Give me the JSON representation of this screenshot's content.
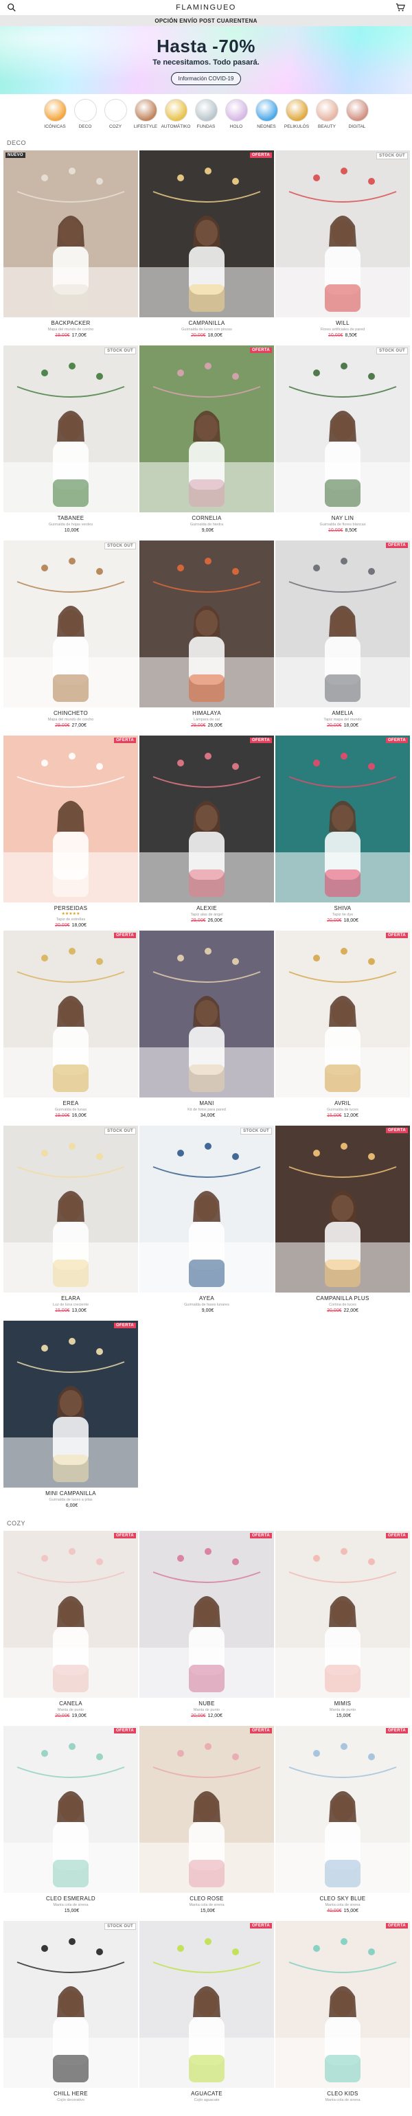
{
  "header": {
    "brand": "FLAMINGUEO",
    "icons": [
      "search-icon",
      "cart-icon"
    ]
  },
  "notice": "OPCIÓN ENVÍO POST CUARENTENA",
  "hero": {
    "title": "Hasta -70%",
    "subtitle": "Te necesitamos. Todo pasará.",
    "button": "Información COVID-19"
  },
  "categories": [
    {
      "label": "ICÓNICAS",
      "color": "#f4a63a"
    },
    {
      "label": "DECO",
      "color": "#ffffff"
    },
    {
      "label": "COZY",
      "color": "#ffffff"
    },
    {
      "label": "LIFESTYLE",
      "color": "#c0845c"
    },
    {
      "label": "AUTOMÁTIKO",
      "color": "#e8c24a"
    },
    {
      "label": "FUNDAS",
      "color": "#b9c6cc"
    },
    {
      "label": "HOLO",
      "color": "#d6b8e6"
    },
    {
      "label": "NEONES",
      "color": "#4aa8e8"
    },
    {
      "label": "PELIKULÓS",
      "color": "#e0a93c"
    },
    {
      "label": "BEAUTY",
      "color": "#e7b5a2"
    },
    {
      "label": "DIGITAL",
      "color": "#d09080"
    }
  ],
  "sections": [
    {
      "title": "DECO",
      "products": [
        {
          "name": "BACKPACKER",
          "desc": "Mapa del mundo de corcho",
          "old": "19,00€",
          "now": "17,00€",
          "badge": "NUEVO",
          "badge_type": "nuevo",
          "bg": "#c9b8a8",
          "accent": "#e9e2d8"
        },
        {
          "name": "CAMPANILLA",
          "desc": "Guirnalda de luces con pinzas",
          "old": "20,00€",
          "now": "18,00€",
          "badge": "OFERTA",
          "badge_type": "sale",
          "bg": "#3b3734",
          "accent": "#f5d58a"
        },
        {
          "name": "WILL",
          "desc": "Flores artificiales de pared",
          "old": "10,00€",
          "now": "8,50€",
          "badge": "STOCK OUT",
          "badge_type": "stock",
          "bg": "#e6e3e3",
          "accent": "#d84a4a"
        },
        {
          "name": "TABANEE",
          "desc": "Guirnalda de hojas verdes",
          "old": "",
          "now": "10,00€",
          "badge": "STOCK OUT",
          "badge_type": "stock",
          "bg": "#e9e8e4",
          "accent": "#3f7a3a"
        },
        {
          "name": "CORNELIA",
          "desc": "Guirnalda de hiedra",
          "old": "",
          "now": "9,00€",
          "badge": "OFERTA",
          "badge_type": "sale",
          "bg": "#7c9a66",
          "accent": "#d9a4b3"
        },
        {
          "name": "NAY LIN",
          "desc": "Guirnalda de flores blancas",
          "old": "10,00€",
          "now": "8,50€",
          "badge": "STOCK OUT",
          "badge_type": "stock",
          "bg": "#ececec",
          "accent": "#3f6e3a"
        },
        {
          "name": "CHINCHETO",
          "desc": "Mapa del mundo de corcho",
          "old": "29,00€",
          "now": "27,00€",
          "badge": "STOCK OUT",
          "badge_type": "stock",
          "bg": "#f3f1ee",
          "accent": "#b0804f"
        },
        {
          "name": "HIMALAYA",
          "desc": "Lámpara de sal",
          "old": "29,00€",
          "now": "26,00€",
          "badge": "",
          "badge_type": "",
          "bg": "#5a4a44",
          "accent": "#e06a3a"
        },
        {
          "name": "AMELIA",
          "desc": "Tapiz mapa del mundo",
          "old": "20,00€",
          "now": "18,00€",
          "badge": "OFERTA",
          "badge_type": "sale",
          "bg": "#dcdcdc",
          "accent": "#666a70"
        },
        {
          "name": "PERSEIDAS",
          "desc": "Tapiz de estrellas",
          "old": "20,00€",
          "now": "18,00€",
          "badge": "OFERTA",
          "badge_type": "sale",
          "bg": "#f4c7b6",
          "accent": "#ffffff",
          "stars": "★★★★★"
        },
        {
          "name": "ALEXIE",
          "desc": "Tapiz alas de ángel",
          "old": "29,00€",
          "now": "26,00€",
          "badge": "OFERTA",
          "badge_type": "sale",
          "bg": "#3a3a3a",
          "accent": "#e77c8a"
        },
        {
          "name": "SHIVA",
          "desc": "Tapiz tie dye",
          "old": "20,00€",
          "now": "18,00€",
          "badge": "OFERTA",
          "badge_type": "sale",
          "bg": "#2a7d7a",
          "accent": "#e84a6a"
        },
        {
          "name": "EREA",
          "desc": "Guirnalda de lunas",
          "old": "19,00€",
          "now": "16,00€",
          "badge": "OFERTA",
          "badge_type": "sale",
          "bg": "#ece9e4",
          "accent": "#d9b25a"
        },
        {
          "name": "MANI",
          "desc": "Kit de fotos para pared",
          "old": "",
          "now": "34,00€",
          "badge": "",
          "badge_type": "",
          "bg": "#6a6478",
          "accent": "#e8d4b0"
        },
        {
          "name": "AVRIL",
          "desc": "Guirnalda de luces",
          "old": "15,00€",
          "now": "12,00€",
          "badge": "OFERTA",
          "badge_type": "sale",
          "bg": "#f1ede8",
          "accent": "#d6a64a"
        },
        {
          "name": "ELARA",
          "desc": "Luz de luna creciente",
          "old": "15,00€",
          "now": "13,00€",
          "badge": "STOCK OUT",
          "badge_type": "stock",
          "bg": "#e6e4e0",
          "accent": "#f2dba0"
        },
        {
          "name": "AYEA",
          "desc": "Guirnalda de fases lunares",
          "old": "",
          "now": "9,00€",
          "badge": "STOCK OUT",
          "badge_type": "stock",
          "bg": "#eef1f4",
          "accent": "#2f5a8a"
        },
        {
          "name": "CAMPANILLA PLUS",
          "desc": "Cortina de luces",
          "old": "30,00€",
          "now": "22,00€",
          "badge": "OFERTA",
          "badge_type": "sale",
          "bg": "#4d3b33",
          "accent": "#f5c77a"
        },
        {
          "name": "MINI CAMPANILLA",
          "desc": "Guirnalda de luces a pilas",
          "old": "",
          "now": "6,00€",
          "badge": "OFERTA",
          "badge_type": "sale",
          "bg": "#2d3a4a",
          "accent": "#f3e2b0"
        }
      ]
    },
    {
      "title": "COZY",
      "products": [
        {
          "name": "CANELA",
          "desc": "Manta de punto",
          "old": "20,00€",
          "now": "19,00€",
          "badge": "OFERTA",
          "badge_type": "sale",
          "bg": "#ede8e4",
          "accent": "#efc3c0"
        },
        {
          "name": "NUBE",
          "desc": "Manta de punto",
          "old": "20,00€",
          "now": "12,00€",
          "badge": "OFERTA",
          "badge_type": "sale",
          "bg": "#e3e1e4",
          "accent": "#d67a9a"
        },
        {
          "name": "MIMIS",
          "desc": "Manta de punto",
          "old": "",
          "now": "15,00€",
          "badge": "OFERTA",
          "badge_type": "sale",
          "bg": "#f0ece8",
          "accent": "#f2b8b0"
        },
        {
          "name": "CLEO ESMERALD",
          "desc": "Manta cola de sirena",
          "old": "",
          "now": "15,00€",
          "badge": "OFERTA",
          "badge_type": "sale",
          "bg": "#f2f2f2",
          "accent": "#8fd0c0"
        },
        {
          "name": "CLEO ROSE",
          "desc": "Manta cola de sirena",
          "old": "",
          "now": "15,00€",
          "badge": "OFERTA",
          "badge_type": "sale",
          "bg": "#e9ddd0",
          "accent": "#e8a8b0"
        },
        {
          "name": "CLEO SKY BLUE",
          "desc": "Manta cola de sirena",
          "old": "40,00€",
          "now": "15,00€",
          "badge": "OFERTA",
          "badge_type": "sale",
          "bg": "#f4f2ee",
          "accent": "#9ec0dc"
        },
        {
          "name": "CHILL HERE",
          "desc": "Cojín decorativo",
          "old": "",
          "now": "",
          "badge": "STOCK OUT",
          "badge_type": "stock",
          "bg": "#efefef",
          "accent": "#222222"
        },
        {
          "name": "AGUACATE",
          "desc": "Cojín aguacate",
          "old": "",
          "now": "",
          "badge": "OFERTA",
          "badge_type": "sale",
          "bg": "#e8e8ea",
          "accent": "#bfe04a"
        },
        {
          "name": "CLEO KIDS",
          "desc": "Manta cola de sirena",
          "old": "",
          "now": "",
          "badge": "OFERTA",
          "badge_type": "sale",
          "bg": "#f2ebe6",
          "accent": "#7ccfc0"
        }
      ]
    }
  ]
}
